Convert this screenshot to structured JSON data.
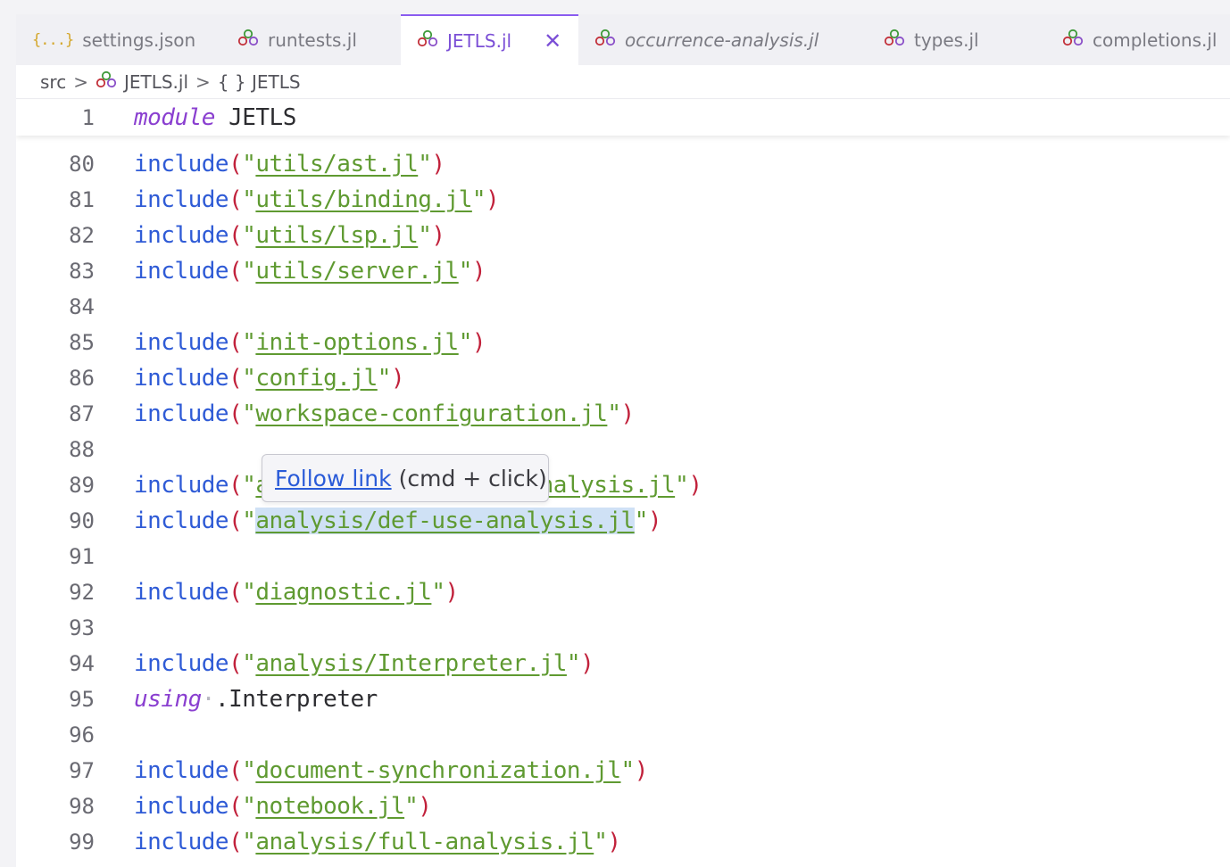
{
  "tabs": [
    {
      "label": "settings.json",
      "icon": "json-braces-icon"
    },
    {
      "label": "runtests.jl",
      "icon": "julia-icon"
    },
    {
      "label": "JETLS.jl",
      "icon": "julia-icon",
      "active": true
    },
    {
      "label": "occurrence-analysis.jl",
      "icon": "julia-icon",
      "italic": true
    },
    {
      "label": "types.jl",
      "icon": "julia-icon"
    },
    {
      "label": "completions.jl",
      "icon": "julia-icon"
    }
  ],
  "json_icon_glyph": "{...}",
  "close_glyph": "✕",
  "breadcrumb": {
    "folder": "src",
    "file": "JETLS.jl",
    "symbol": "{ } JETLS",
    "separator": ">"
  },
  "sticky_line": {
    "number": "1",
    "keyword": "module",
    "name": "JETLS"
  },
  "include_keyword": "include",
  "lines": [
    {
      "n": "80",
      "file": "utils/ast.jl"
    },
    {
      "n": "81",
      "file": "utils/binding.jl"
    },
    {
      "n": "82",
      "file": "utils/lsp.jl"
    },
    {
      "n": "83",
      "file": "utils/server.jl"
    },
    {
      "n": "84"
    },
    {
      "n": "85",
      "file": "init-options.jl"
    },
    {
      "n": "86",
      "file": "config.jl"
    },
    {
      "n": "87",
      "file": "workspace-configuration.jl"
    },
    {
      "n": "88"
    },
    {
      "n": "89",
      "file": "analysis/occurrence-analysis.jl"
    },
    {
      "n": "90",
      "file": "analysis/def-use-analysis.jl",
      "highlight": true
    },
    {
      "n": "91"
    },
    {
      "n": "92",
      "file": "diagnostic.jl"
    },
    {
      "n": "93"
    },
    {
      "n": "94",
      "file": "analysis/Interpreter.jl"
    },
    {
      "n": "95",
      "using": ".Interpreter"
    },
    {
      "n": "96"
    },
    {
      "n": "97",
      "file": "document-synchronization.jl"
    },
    {
      "n": "98",
      "file": "notebook.jl"
    },
    {
      "n": "99",
      "file": "analysis/full-analysis.jl"
    }
  ],
  "using_keyword": "using",
  "tooltip": {
    "link_text": "Follow link",
    "hint": "(cmd + click)"
  },
  "colors": {
    "keyword": "#2f5bd6",
    "keyword_italic": "#8a3fd0",
    "paren": "#c1213b",
    "string": "#5f9a31",
    "active_tab": "#7b4fd6",
    "selection": "#cfe1f5"
  }
}
